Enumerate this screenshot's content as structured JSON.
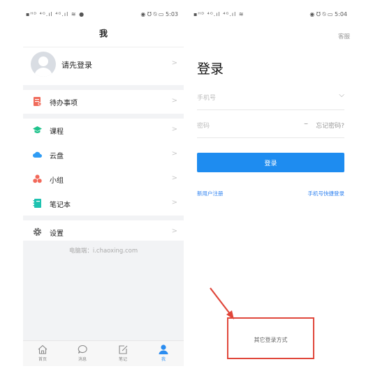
{
  "left": {
    "status": {
      "left": "▪ᴴᴰ ⁴ᴳ.ıl ⁴ᴳ.ıl ≋ ●",
      "right": "◉ ℧ ⍉ ▭ 5:03"
    },
    "title": "我",
    "login_prompt": "请先登录",
    "menu": [
      {
        "label": "待办事项",
        "icon": "todo-icon",
        "color": "#f06a5a"
      },
      {
        "label": "课程",
        "icon": "graduation-cap-icon",
        "color": "#1ec28b"
      },
      {
        "label": "云盘",
        "icon": "cloud-icon",
        "color": "#2f9cf4"
      },
      {
        "label": "小组",
        "icon": "group-icon",
        "color": "#f2695a"
      },
      {
        "label": "笔记本",
        "icon": "notebook-icon",
        "color": "#1ec2b0"
      },
      {
        "label": "设置",
        "icon": "gear-icon",
        "color": "#666666"
      }
    ],
    "pc_info": "电脑端：i.chaoxing.com",
    "tabs": [
      {
        "label": "首页",
        "icon": "home-icon"
      },
      {
        "label": "消息",
        "icon": "message-icon"
      },
      {
        "label": "笔记",
        "icon": "note-icon"
      },
      {
        "label": "我",
        "icon": "person-icon"
      }
    ],
    "chevron": ">"
  },
  "right": {
    "status": {
      "left": "▪ᴴᴰ ⁴ᴳ.ıl ⁴ᴳ.ıl ≋",
      "right": "◉ ℧ ⍉ ▭ 5:04"
    },
    "service": "客服",
    "title": "登录",
    "phone_placeholder": "手机号",
    "password_placeholder": "密码",
    "forgot": "忘记密码?",
    "login_button": "登录",
    "register": "新用户注册",
    "quick_login": "手机号快捷登录",
    "other_login": "其它登录方式",
    "accent": "#1e8cf0",
    "highlight": "#e0463a"
  }
}
